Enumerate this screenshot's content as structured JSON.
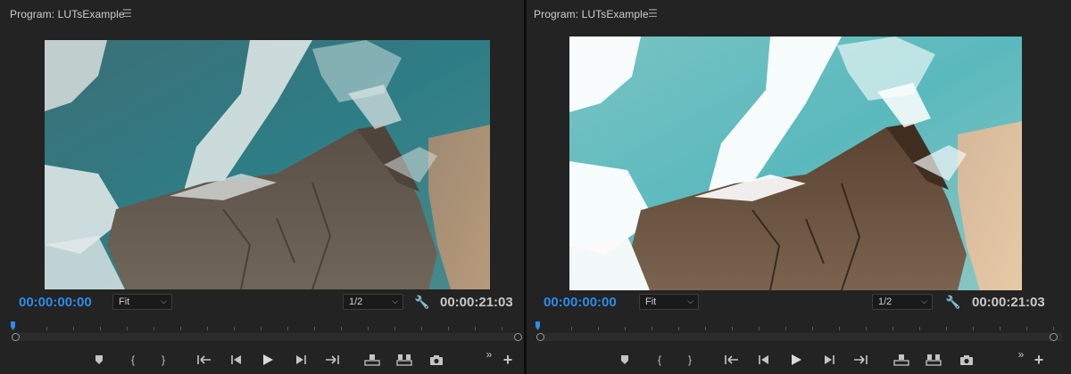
{
  "monitors": [
    {
      "title": "Program: LUTsExample",
      "menu_icon": "menu-icon",
      "current_timecode": "00:00:00:00",
      "fit_value": "Fit",
      "resolution_value": "1/2",
      "duration_timecode": "00:00:21:03",
      "preview": "original ocean coastline footage (before LUT)",
      "playhead_fraction": 0
    },
    {
      "title": "Program: LUTsExample",
      "menu_icon": "menu-icon",
      "current_timecode": "00:00:00:00",
      "fit_value": "Fit",
      "resolution_value": "1/2",
      "duration_timecode": "00:00:21:03",
      "preview": "ocean coastline footage with LUT applied (brighter, higher contrast)",
      "playhead_fraction": 0
    }
  ],
  "colors": {
    "timecode_blue": "#2d8ceb",
    "panel_bg": "#232323",
    "divider": "#0c0c0c"
  },
  "controls": [
    "add-marker-icon",
    "mark-in-icon",
    "mark-out-icon",
    "go-to-in-icon",
    "step-back-icon",
    "play-icon",
    "step-forward-icon",
    "go-to-out-icon",
    "lift-icon",
    "extract-icon",
    "export-frame-icon"
  ]
}
